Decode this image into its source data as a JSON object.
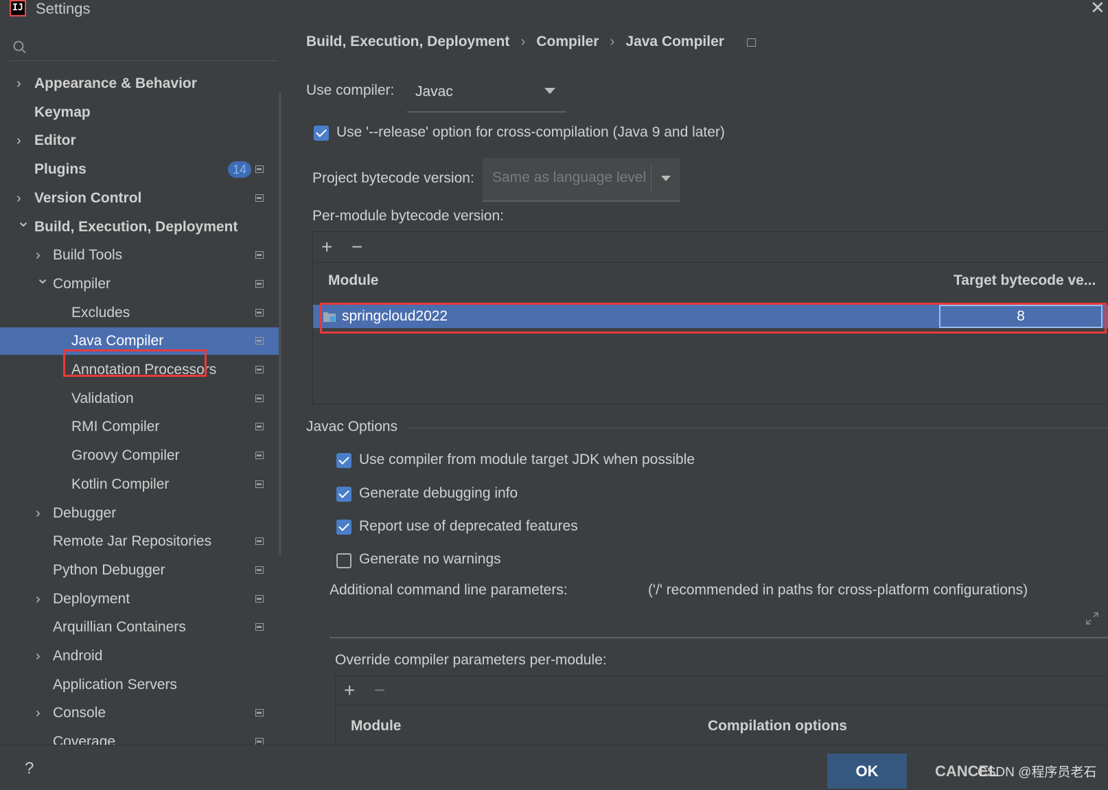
{
  "window": {
    "title": "Settings",
    "icon_text": "IJ",
    "close_icon": "close-icon"
  },
  "sidebar": {
    "search_icon": "search-icon",
    "items": [
      {
        "label": "Appearance & Behavior",
        "level": 0,
        "chevron": "right",
        "bold": true
      },
      {
        "label": "Keymap",
        "level": 0,
        "chevron": "",
        "bold": true
      },
      {
        "label": "Editor",
        "level": 0,
        "chevron": "right",
        "bold": true
      },
      {
        "label": "Plugins",
        "level": 0,
        "chevron": "",
        "bold": true,
        "badge": "14",
        "project_icon": true
      },
      {
        "label": "Version Control",
        "level": 0,
        "chevron": "right",
        "bold": true,
        "project_icon": true
      },
      {
        "label": "Build, Execution, Deployment",
        "level": 0,
        "chevron": "down",
        "bold": true
      },
      {
        "label": "Build Tools",
        "level": 1,
        "chevron": "right",
        "project_icon": true
      },
      {
        "label": "Compiler",
        "level": 1,
        "chevron": "down",
        "project_icon": true
      },
      {
        "label": "Excludes",
        "level": 2,
        "chevron": "",
        "project_icon": true
      },
      {
        "label": "Java Compiler",
        "level": 2,
        "chevron": "",
        "project_icon": true,
        "selected": true
      },
      {
        "label": "Annotation Processors",
        "level": 2,
        "chevron": "",
        "project_icon": true
      },
      {
        "label": "Validation",
        "level": 2,
        "chevron": "",
        "project_icon": true
      },
      {
        "label": "RMI Compiler",
        "level": 2,
        "chevron": "",
        "project_icon": true
      },
      {
        "label": "Groovy Compiler",
        "level": 2,
        "chevron": "",
        "project_icon": true
      },
      {
        "label": "Kotlin Compiler",
        "level": 2,
        "chevron": "",
        "project_icon": true
      },
      {
        "label": "Debugger",
        "level": 1,
        "chevron": "right"
      },
      {
        "label": "Remote Jar Repositories",
        "level": 1,
        "chevron": "",
        "project_icon": true
      },
      {
        "label": "Python Debugger",
        "level": 1,
        "chevron": "",
        "project_icon": true
      },
      {
        "label": "Deployment",
        "level": 1,
        "chevron": "right",
        "project_icon": true
      },
      {
        "label": "Arquillian Containers",
        "level": 1,
        "chevron": "",
        "project_icon": true
      },
      {
        "label": "Android",
        "level": 1,
        "chevron": "right"
      },
      {
        "label": "Application Servers",
        "level": 1,
        "chevron": ""
      },
      {
        "label": "Console",
        "level": 1,
        "chevron": "right",
        "project_icon": true
      },
      {
        "label": "Coverage",
        "level": 1,
        "chevron": "",
        "project_icon": true
      }
    ]
  },
  "breadcrumb": {
    "parts": [
      "Build, Execution, Deployment",
      "Compiler",
      "Java Compiler"
    ],
    "separator": "›"
  },
  "compiler": {
    "label": "Use compiler:",
    "value": "Javac",
    "release_option": {
      "label": "Use '--release' option for cross-compilation (Java 9 and later)",
      "checked": true
    },
    "bytecode_label": "Project bytecode version:",
    "bytecode_value": "Same as language level",
    "per_module_label": "Per-module bytecode version:",
    "add_btn": "+",
    "remove_btn": "−",
    "table": {
      "col_module": "Module",
      "col_target": "Target bytecode ve...",
      "rows": [
        {
          "module": "springcloud2022",
          "target": "8"
        }
      ]
    }
  },
  "javac": {
    "section_title": "Javac Options",
    "options": [
      {
        "label": "Use compiler from module target JDK when possible",
        "checked": true
      },
      {
        "label": "Generate debugging info",
        "checked": true
      },
      {
        "label": "Report use of deprecated features",
        "checked": true
      },
      {
        "label": "Generate no warnings",
        "checked": false
      }
    ],
    "params_label": "Additional command line parameters:",
    "params_hint": "('/' recommended in paths for cross-platform configurations)",
    "override_label": "Override compiler parameters per-module:",
    "override_add": "+",
    "override_remove": "−",
    "override_col_module": "Module",
    "override_col_options": "Compilation options"
  },
  "footer": {
    "help": "?",
    "ok": "OK",
    "cancel": "CANCEL",
    "watermark": "CSDN @程序员老石"
  },
  "colors": {
    "accent": "#4b6eaf",
    "highlight": "#e83a3a",
    "ok_bg": "#365880"
  }
}
